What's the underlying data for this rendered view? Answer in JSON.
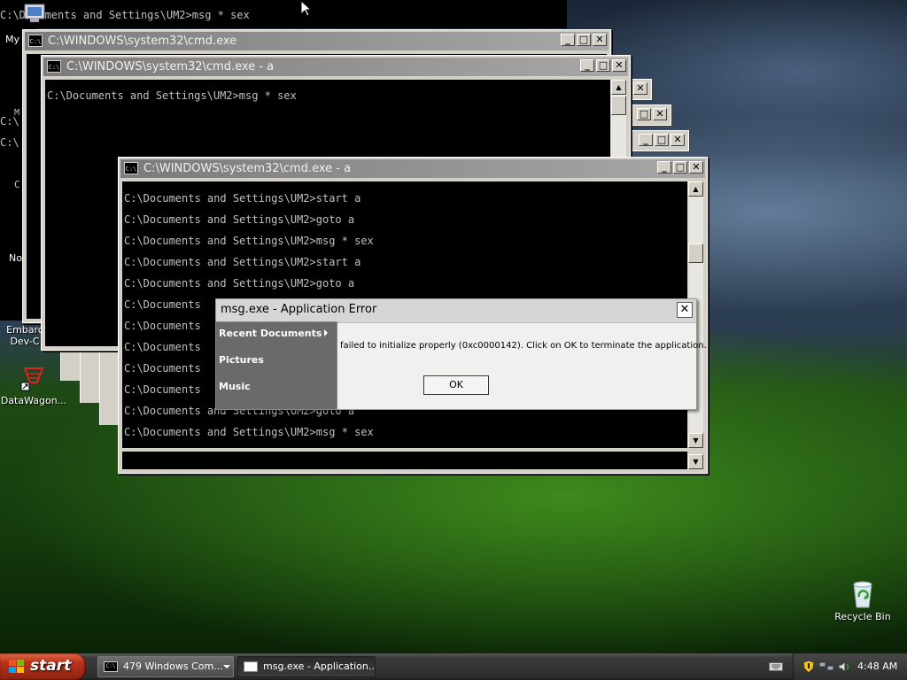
{
  "desktop": {
    "icons": [
      {
        "label": "My"
      },
      {
        "label": "Embarc"
      },
      {
        "label": "Dev-C"
      },
      {
        "label": "DataWagon..."
      },
      {
        "label": "Recycle Bin"
      }
    ],
    "left_fragments": [
      "M",
      "C:\\",
      "C:\\",
      "C",
      "No"
    ]
  },
  "windows": {
    "top_bg": {
      "prompt_line": "C:\\Documents and Settings\\UM2>msg * sex",
      "prefix": "C:\\"
    },
    "w1": {
      "title": "C:\\WINDOWS\\system32\\cmd.exe",
      "icon": "C:\\",
      "minimize": "_",
      "maximize": "□",
      "close": "✕"
    },
    "w2": {
      "title": "C:\\WINDOWS\\system32\\cmd.exe - a",
      "icon": "C:\\",
      "minimize": "_",
      "maximize": "□",
      "close": "✕",
      "lines": [
        "C:\\Documents and Settings\\UM2>msg * sex"
      ]
    },
    "w3": {
      "title": "C:\\WINDOWS\\system32\\cmd.exe - a",
      "icon": "C:\\",
      "minimize": "_",
      "maximize": "□",
      "close": "✕",
      "lines": [
        "C:\\Documents and Settings\\UM2>start a",
        "C:\\Documents and Settings\\UM2>goto a",
        "C:\\Documents and Settings\\UM2>msg * sex",
        "C:\\Documents and Settings\\UM2>start a",
        "C:\\Documents and Settings\\UM2>goto a",
        "C:\\Documents",
        "C:\\Documents",
        "C:\\Documents",
        "C:\\Documents",
        "C:\\Documents",
        "C:\\Documents and Settings\\UM2>goto a",
        "C:\\Documents and Settings\\UM2>msg * sex"
      ]
    },
    "stack_buttons": {
      "minimize": "_",
      "maximize": "□",
      "close": "✕"
    }
  },
  "dialog": {
    "title": "msg.exe - Application Error",
    "message": "failed to initialize properly (0xc0000142). Click on OK to terminate the application.",
    "ok": "OK",
    "close": "✕"
  },
  "start_menu": {
    "items": [
      "Recent Documents",
      "Pictures",
      "Music"
    ]
  },
  "taskbar": {
    "start_label": "start",
    "buttons": [
      {
        "label": "479 Windows Com...",
        "icon": "C:\\"
      },
      {
        "label": "msg.exe - Application..."
      }
    ],
    "clock": "4:48 AM",
    "brand_colors": {
      "flag_red": "#f25022",
      "flag_green": "#7fba00",
      "flag_blue": "#00a4ef",
      "flag_yellow": "#ffb900"
    }
  }
}
